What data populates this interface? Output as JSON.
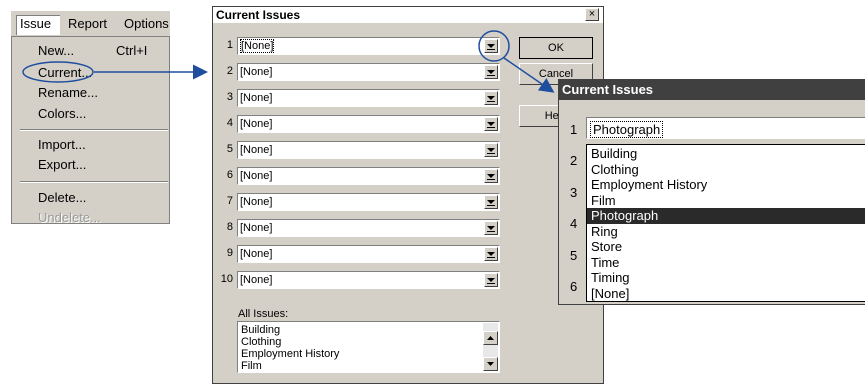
{
  "menubar": {
    "items": [
      "Issue",
      "Report",
      "Options"
    ]
  },
  "menu": {
    "items": [
      {
        "label": "New...",
        "shortcut": "Ctrl+I",
        "disabled": false
      },
      {
        "label": "Current...",
        "shortcut": "",
        "disabled": false
      },
      {
        "label": "Rename...",
        "shortcut": "",
        "disabled": false
      },
      {
        "label": "Colors...",
        "shortcut": "",
        "disabled": false
      },
      {
        "label": "Import...",
        "shortcut": "",
        "disabled": false
      },
      {
        "label": "Export...",
        "shortcut": "",
        "disabled": false
      },
      {
        "label": "Delete...",
        "shortcut": "",
        "disabled": false
      },
      {
        "label": "Undelete...",
        "shortcut": "",
        "disabled": true
      }
    ]
  },
  "dialog": {
    "title": "Current Issues",
    "close_label": "×",
    "rows": [
      {
        "num": "1",
        "value": "[None]"
      },
      {
        "num": "2",
        "value": "[None]"
      },
      {
        "num": "3",
        "value": "[None]"
      },
      {
        "num": "4",
        "value": "[None]"
      },
      {
        "num": "5",
        "value": "[None]"
      },
      {
        "num": "6",
        "value": "[None]"
      },
      {
        "num": "7",
        "value": "[None]"
      },
      {
        "num": "8",
        "value": "[None]"
      },
      {
        "num": "9",
        "value": "[None]"
      },
      {
        "num": "10",
        "value": "[None]"
      }
    ],
    "ok_label": "OK",
    "cancel_label": "Cancel",
    "help_label": "Help",
    "all_issues_label": "All Issues:",
    "all_issues": [
      "Building",
      "Clothing",
      "Employment History",
      "Film"
    ]
  },
  "dialog2": {
    "title": "Current Issues",
    "row_numbers": [
      "1",
      "2",
      "3",
      "4",
      "5",
      "6"
    ],
    "selected_value": "Photograph",
    "options": [
      "Building",
      "Clothing",
      "Employment History",
      "Film",
      "Photograph",
      "Ring",
      "Store",
      "Time",
      "Timing",
      "[None]"
    ],
    "highlighted_option": "Photograph"
  },
  "colors": {
    "dialog_bg": "#d4d0c8",
    "title_bar_active": "#404040",
    "arrow": "#1f4e9e",
    "highlight": "#2a2a2a"
  }
}
